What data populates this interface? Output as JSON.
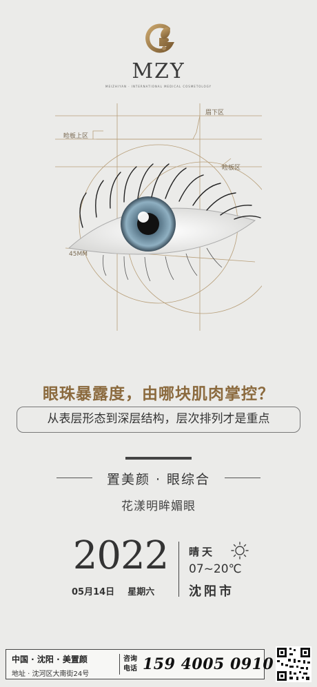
{
  "brand": {
    "name": "MZY",
    "tagline": "MEIZHIYAN · INTERNATIONAL MEDICAL COSMETOLOGY",
    "gold": "#a8875a"
  },
  "eye_zones": {
    "brow_lower": "眉下区",
    "upper_lid": "睑板上区",
    "lid_plate": "睑板区",
    "measure": "45MM"
  },
  "headline": "眼珠暴露度，由哪块肌肉掌控？",
  "subline": "从表层形态到深层结构，层次排列才是重点",
  "section": {
    "title": "置美颜 · 眼综合",
    "subtitle": "花漾明眸媚眼"
  },
  "date": {
    "year": "2022",
    "day": "05月14日",
    "weekday": "星期六"
  },
  "weather": {
    "condition": "晴天",
    "icon": "sun-icon",
    "temp": "07~20℃",
    "city": "沈阳市"
  },
  "footer": {
    "line1": "中国 · 沈阳 · 美置颜",
    "line2": "地址 · 沈河区大南街24号",
    "consult_label": "咨询 电话",
    "phone": "159 4005 0910"
  },
  "colors": {
    "accent": "#8b6a3e",
    "background": "#ebebe9"
  }
}
